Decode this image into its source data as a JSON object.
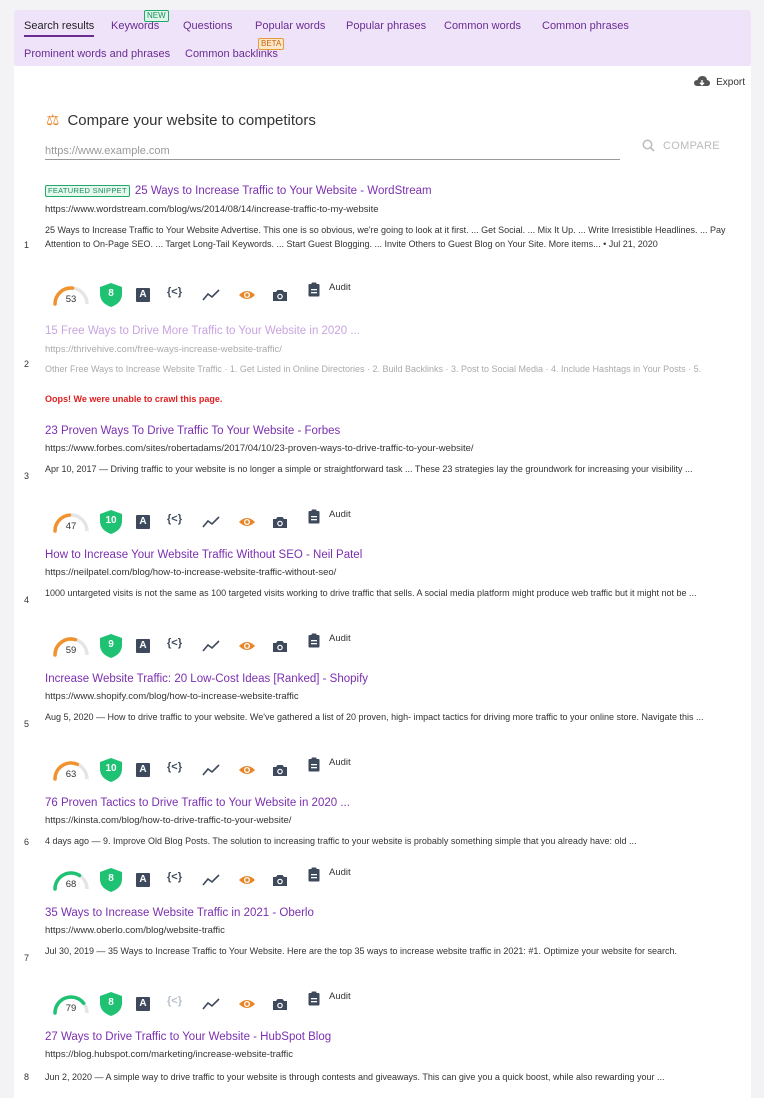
{
  "tabs": [
    {
      "label": "Search results",
      "active": true
    },
    {
      "label": "Keywords",
      "badge": "NEW"
    },
    {
      "label": "Questions"
    },
    {
      "label": "Popular words"
    },
    {
      "label": "Popular phrases"
    },
    {
      "label": "Common words"
    },
    {
      "label": "Common phrases"
    },
    {
      "label": "Prominent words and phrases"
    },
    {
      "label": "Common backlinks",
      "badge": "BETA"
    }
  ],
  "export_label": "Export",
  "compare": {
    "title": "Compare your website to competitors",
    "placeholder": "https://www.example.com",
    "button_label": "COMPARE"
  },
  "featured_badge": "FEATURED SNIPPET",
  "error_text": "Oops! We were unable to crawl this page.",
  "audit_label": "Audit",
  "colors": {
    "accent": "#7b2fb0",
    "gauge_orange": "#f0922e",
    "gauge_green": "#1fc172",
    "shield_green": "#1fc172",
    "error": "#e02020",
    "tab_bg": "#efe3fa"
  },
  "results": [
    {
      "rank": "1",
      "title": "25 Ways to Increase Traffic to Your Website - WordStream",
      "url": "https://www.wordstream.com/blog/ws/2014/08/14/increase-traffic-to-my-website",
      "snippet": "25 Ways to Increase Traffic to Your Website Advertise. This one is so obvious, we're going to look at it first. ... Get Social. ... Mix It Up. ... Write Irresistible Headlines. ... Pay Attention to On-Page SEO. ... Target Long-Tail Keywords. ... Start Guest Blogging. ... Invite Others to Guest Blog on Your Site. More items... • Jul 21, 2020",
      "featured": true,
      "score": "53",
      "authority": "8"
    },
    {
      "rank": "2",
      "title": "15 Free Ways to Drive More Traffic to Your Website in 2020 ...",
      "url": "https://thrivehive.com/free-ways-increase-website-traffic/",
      "snippet": "Other Free Ways to Increase Website Traffic · 1. Get Listed in Online Directories · 2. Build Backlinks · 3. Post to Social Media · 4. Include Hashtags in Your Posts · 5.",
      "error": true
    },
    {
      "rank": "3",
      "title": "23 Proven Ways To Drive Traffic To Your Website - Forbes",
      "url": "https://www.forbes.com/sites/robertadams/2017/04/10/23-proven-ways-to-drive-traffic-to-your-website/",
      "snippet": "Apr 10, 2017 — Driving traffic to your website is no longer a simple or straightforward task ... These 23 strategies lay the groundwork for increasing your visibility ...",
      "score": "47",
      "authority": "10"
    },
    {
      "rank": "4",
      "title": "How to Increase Your Website Traffic Without SEO - Neil Patel",
      "url": "https://neilpatel.com/blog/how-to-increase-website-traffic-without-seo/",
      "snippet": "1000 untargeted visits is not the same as 100 targeted visits working to drive traffic that sells. A social media platform might produce web traffic but it might not be ...",
      "score": "59",
      "authority": "9"
    },
    {
      "rank": "5",
      "title": "Increase Website Traffic: 20 Low-Cost Ideas [Ranked] - Shopify",
      "url": "https://www.shopify.com/blog/how-to-increase-website-traffic",
      "snippet": "Aug 5, 2020 — How to drive traffic to your website. We've gathered a list of 20 proven, high- impact tactics for driving more traffic to your online store. Navigate this ...",
      "score": "63",
      "authority": "10"
    },
    {
      "rank": "6",
      "title": "76 Proven Tactics to Drive Traffic to Your Website in 2020 ...",
      "url": "https://kinsta.com/blog/how-to-drive-traffic-to-your-website/",
      "snippet": "4 days ago — 9. Improve Old Blog Posts. The solution to increasing traffic to your website is probably something simple that you already have: old ...",
      "score": "68",
      "authority": "8"
    },
    {
      "rank": "7",
      "title": "35 Ways to Increase Website Traffic in 2021 - Oberlo",
      "url": "https://www.oberlo.com/blog/website-traffic",
      "snippet": "Jul 30, 2019 — 35 Ways to Increase Traffic to Your Website. Here are the top 35 ways to increase website traffic in 2021: #1. Optimize your website for search.",
      "score": "79",
      "authority": "8"
    },
    {
      "rank": "8",
      "title": "27 Ways to Drive Traffic to Your Website - HubSpot Blog",
      "url": "https://blog.hubspot.com/marketing/increase-website-traffic",
      "snippet": "Jun 2, 2020 — A simple way to drive traffic to your website is through contests and giveaways. This can give you a quick boost, while also rewarding your ..."
    }
  ]
}
